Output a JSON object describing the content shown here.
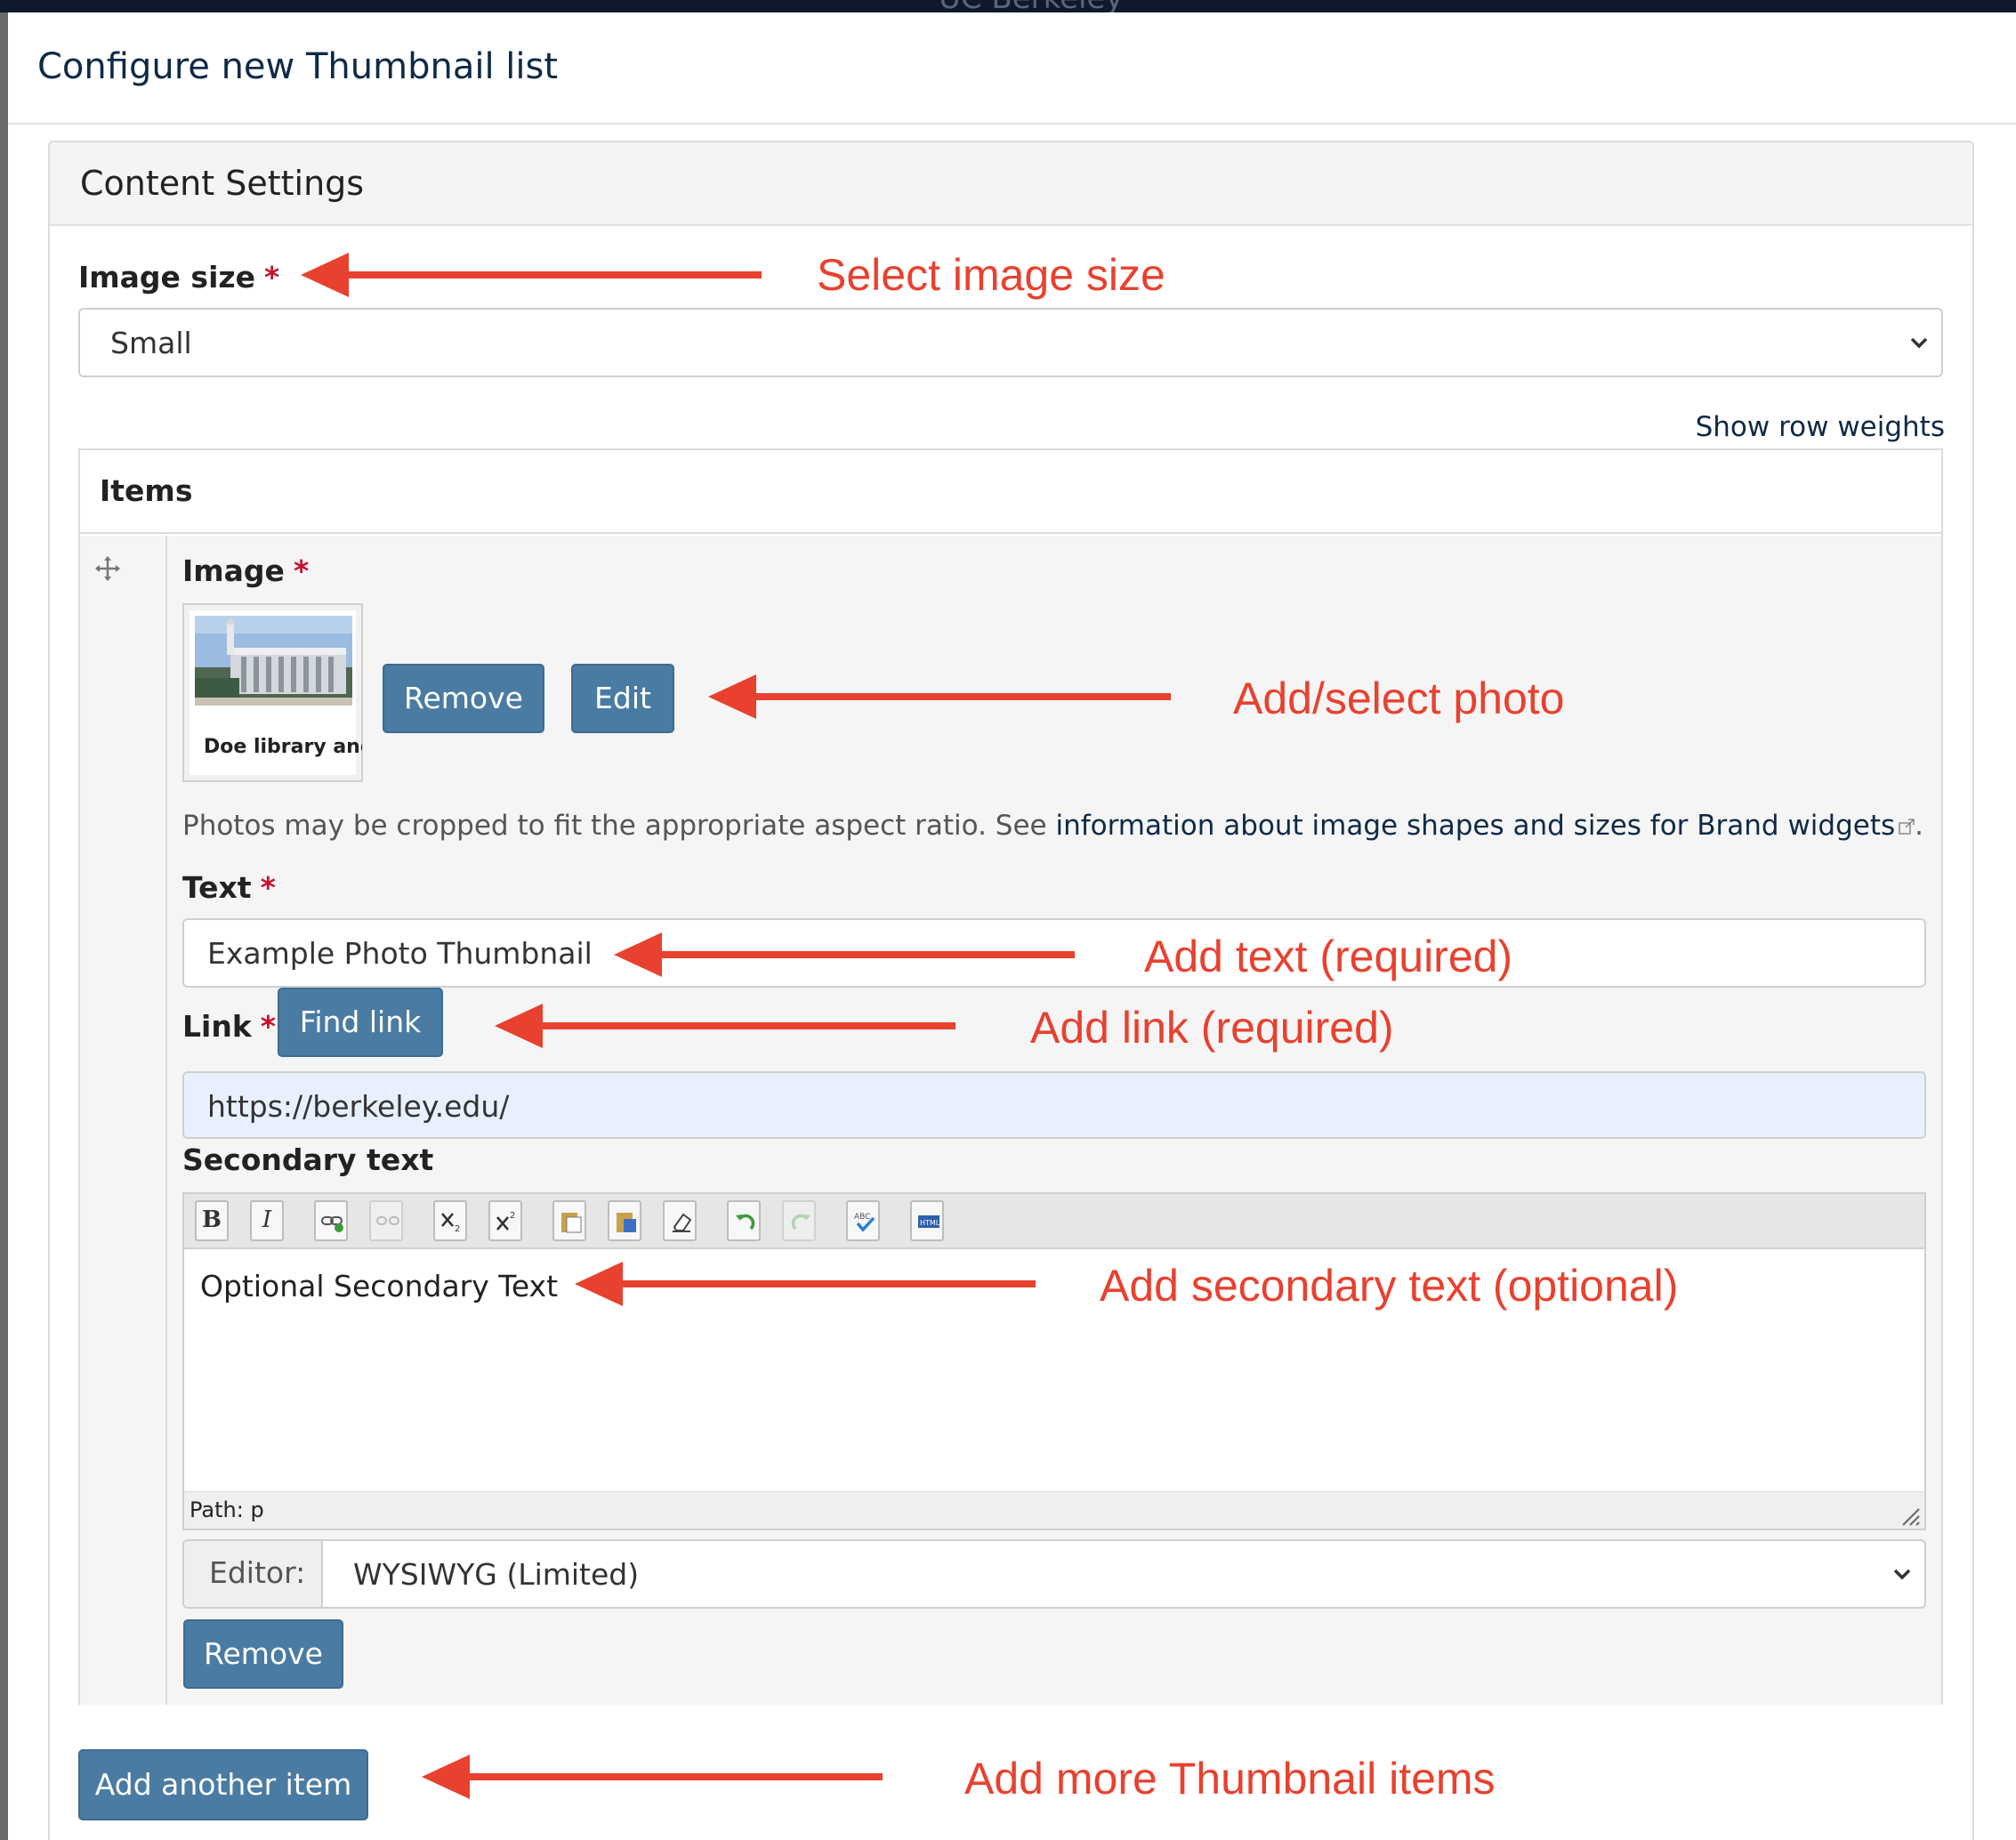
{
  "browser": {
    "top_title": "UC Berkeley"
  },
  "dialog": {
    "title": "Configure new Thumbnail list"
  },
  "panel": {
    "title": "Content Settings"
  },
  "image_size": {
    "label": "Image size",
    "required": "*",
    "value": "Small"
  },
  "row_weights": {
    "label": "Show row weights"
  },
  "items": {
    "title": "Items",
    "item": {
      "image": {
        "label": "Image",
        "required": "*",
        "thumbnail_caption": "Doe library and",
        "remove_label": "Remove",
        "edit_label": "Edit"
      },
      "help": {
        "text": "Photos may be cropped to fit the appropriate aspect ratio. See ",
        "link": "information about image shapes and sizes for Brand widgets",
        "end": "."
      },
      "text": {
        "label": "Text",
        "required": "*",
        "value": "Example Photo Thumbnail"
      },
      "link": {
        "label": "Link",
        "required": "*",
        "find_label": "Find link",
        "value": "https://berkeley.edu/"
      },
      "secondary": {
        "label": "Secondary text",
        "toolbar": [
          "bold-icon",
          "italic-icon",
          "link-icon",
          "unlink-icon",
          "subscript-icon",
          "superscript-icon",
          "paste-icon",
          "paste-word-icon",
          "remove-format-icon",
          "undo-icon",
          "redo-icon",
          "spellcheck-icon",
          "html-source-icon"
        ],
        "bold_glyph": "B",
        "italic_glyph": "I",
        "content": "Optional Secondary Text",
        "path": "Path: p"
      },
      "editor": {
        "label": "Editor:",
        "value": "WYSIWYG (Limited)"
      },
      "remove_label": "Remove"
    },
    "add_label": "Add another item"
  },
  "annotations": {
    "image_size": "Select image size",
    "photo": "Add/select photo",
    "text": "Add text (required)",
    "link": "Add link (required)",
    "secondary": "Add secondary text (optional)",
    "add_more": "Add more Thumbnail items"
  },
  "colors": {
    "accent": "#4a7ba3",
    "annotation": "#e8412f",
    "required": "#c8102e",
    "title": "#0e2a47"
  }
}
